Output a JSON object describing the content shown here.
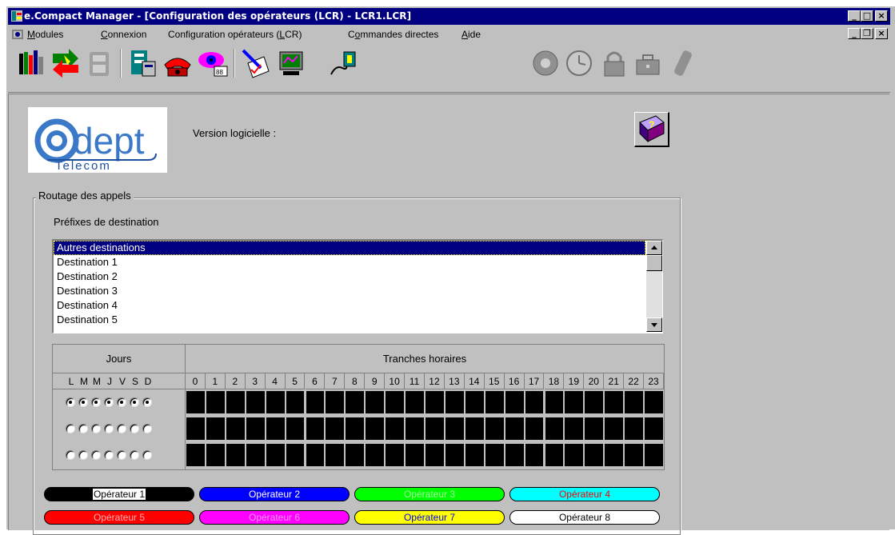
{
  "window": {
    "title": "e.Compact Manager - [Configuration des opérateurs (LCR) - LCR1.LCR]",
    "controls": {
      "minimize": "_",
      "maximize": "□",
      "close": "×"
    },
    "mdi_controls": {
      "minimize": "_",
      "restore": "❐",
      "close": "×"
    }
  },
  "menu": [
    {
      "pre": "",
      "ul": "M",
      "post": "odules"
    },
    {
      "pre": "",
      "ul": "C",
      "post": "onnexion"
    },
    {
      "pre": "Configuration opérateurs (",
      "ul": "L",
      "post": "CR)"
    },
    {
      "pre": "C",
      "ul": "o",
      "post": "mmandes directes"
    },
    {
      "pre": "",
      "ul": "A",
      "post": "ide"
    }
  ],
  "toolbar": {
    "icons": [
      "tools-icon",
      "connection-arrows-icon",
      "phone-disabled-icon",
      "configuration-icon",
      "telephone-icon",
      "monitor-eye-icon",
      "edit-document-icon",
      "network-computer-icon",
      "plug-icon",
      "dial-disabled-icon",
      "clock-disabled-icon",
      "lock-disabled-icon",
      "briefcase-disabled-icon",
      "mobile-disabled-icon"
    ]
  },
  "logo": {
    "text": "dept",
    "sub": "Telecom"
  },
  "version": {
    "label": "Version logicielle :"
  },
  "routing": {
    "group_label": "Routage des appels",
    "prefix_label": "Préfixes de destination",
    "destinations": [
      "Autres destinations",
      "Destination 1",
      "Destination 2",
      "Destination 3",
      "Destination 4",
      "Destination 5"
    ],
    "selected_index": 0
  },
  "schedule": {
    "days_header": "Jours",
    "hours_header": "Tranches horaires",
    "day_letters": [
      "L",
      "M",
      "M",
      "J",
      "V",
      "S",
      "D"
    ],
    "hours": [
      "0",
      "1",
      "2",
      "3",
      "4",
      "5",
      "6",
      "7",
      "8",
      "9",
      "10",
      "11",
      "12",
      "13",
      "14",
      "15",
      "16",
      "17",
      "18",
      "19",
      "20",
      "21",
      "22",
      "23"
    ],
    "rows": [
      {
        "days_checked": [
          true,
          true,
          true,
          true,
          true,
          true,
          true
        ]
      },
      {
        "days_checked": [
          false,
          false,
          false,
          false,
          false,
          false,
          false
        ]
      },
      {
        "days_checked": [
          false,
          false,
          false,
          false,
          false,
          false,
          false
        ]
      }
    ]
  },
  "operators": [
    {
      "label": "Opérateur 1",
      "bg": "#000000",
      "fg": "#ffffff",
      "focused": true
    },
    {
      "label": "Opérateur 2",
      "bg": "#0000ff",
      "fg": "#ffffff"
    },
    {
      "label": "Opérateur 3",
      "bg": "#00ff00",
      "fg": "#a0ffa0"
    },
    {
      "label": "Opérateur 4",
      "bg": "#00ffff",
      "fg": "#ff0000"
    },
    {
      "label": "Opérateur 5",
      "bg": "#ff0000",
      "fg": "#ffb0b0"
    },
    {
      "label": "Opérateur 6",
      "bg": "#ff00ff",
      "fg": "#ff99ff"
    },
    {
      "label": "Opérateur 7",
      "bg": "#ffff00",
      "fg": "#0000ff"
    },
    {
      "label": "Opérateur 8",
      "bg": "#ffffff",
      "fg": "#000000"
    }
  ],
  "colors": {
    "title_bar": "#000080",
    "face": "#c0c0c0",
    "selection": "#000080"
  }
}
